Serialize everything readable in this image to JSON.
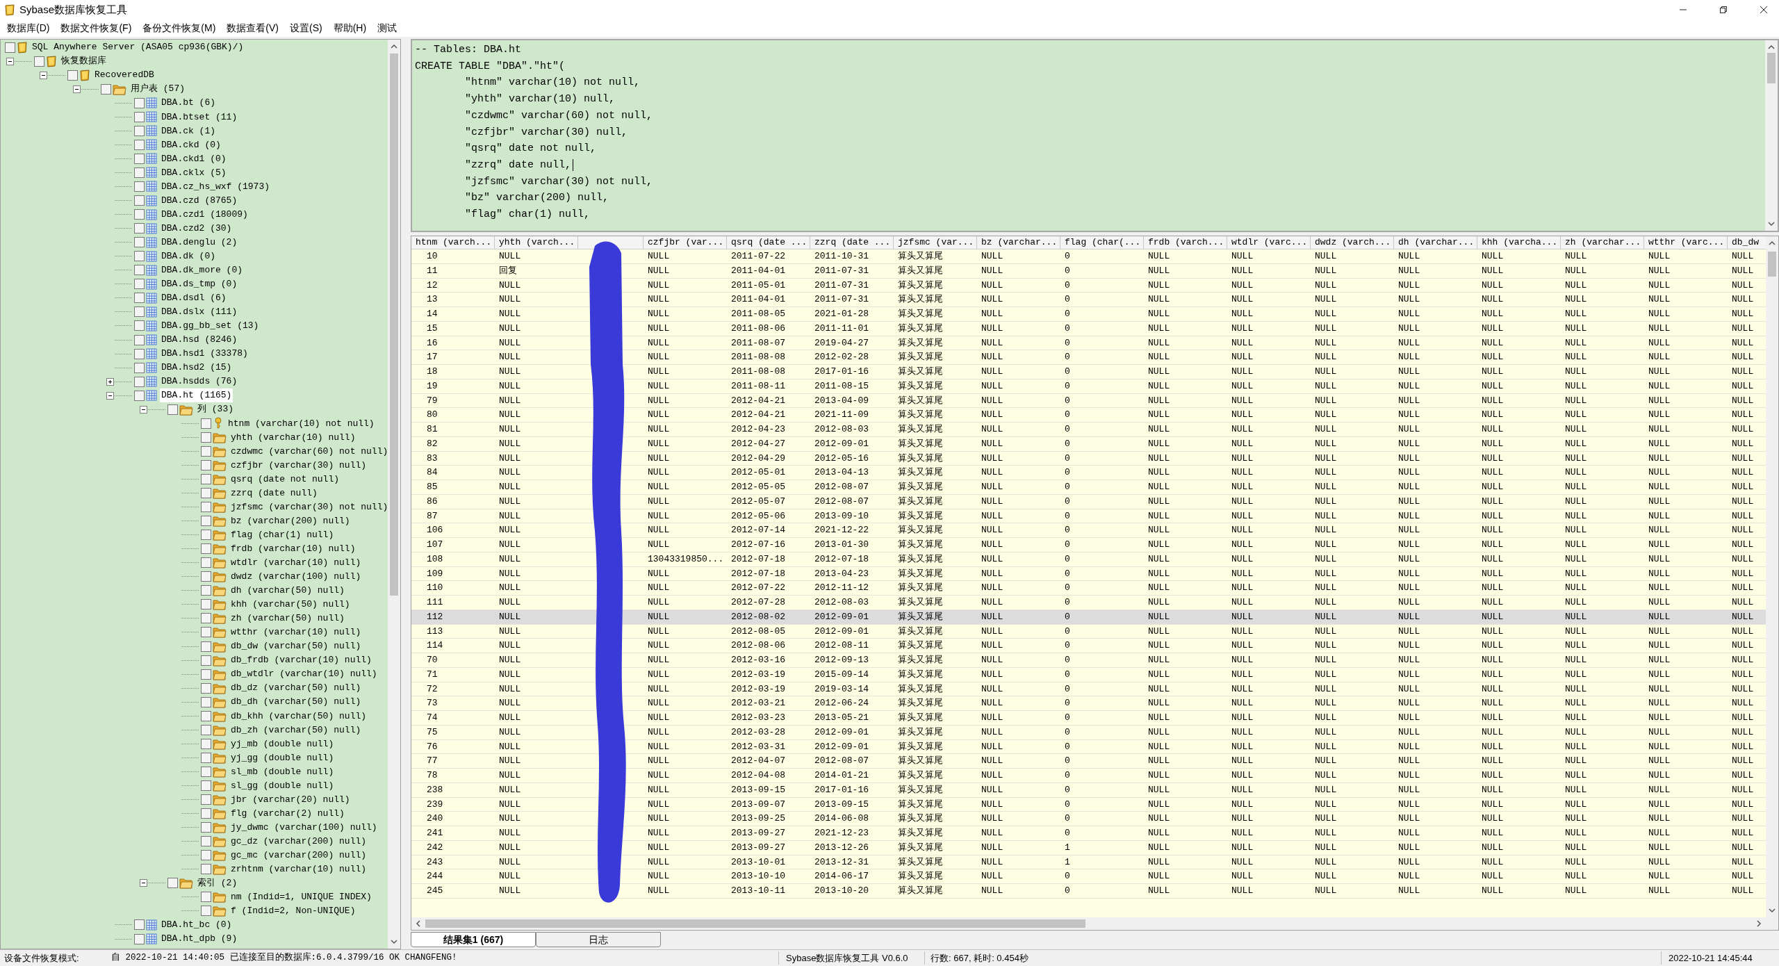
{
  "window": {
    "title": "Sybase数据库恢复工具"
  },
  "menu": [
    "数据库(D)",
    "数据文件恢复(F)",
    "备份文件恢复(M)",
    "数据查看(V)",
    "设置(S)",
    "帮助(H)",
    "测试"
  ],
  "tree": [
    {
      "label": "SQL Anywhere Server (ASA05 cp936(GBK)/)",
      "kind": "database",
      "checked": false,
      "selected": false,
      "children": [
        {
          "label": "恢复数据库",
          "kind": "database",
          "checked": false,
          "selected": false,
          "expanded": true,
          "children": [
            {
              "label": "RecoveredDB",
              "kind": "database",
              "checked": false,
              "selected": false,
              "expanded": true,
              "children": [
                {
                  "label": "用户表 (57)",
                  "kind": "folder",
                  "checked": false,
                  "selected": false,
                  "expanded": true,
                  "children": [
                    {
                      "label": "DBA.bt (6)",
                      "kind": "table",
                      "checked": false,
                      "selected": false
                    },
                    {
                      "label": "DBA.btset (11)",
                      "kind": "table",
                      "checked": false,
                      "selected": false
                    },
                    {
                      "label": "DBA.ck (1)",
                      "kind": "table",
                      "checked": false,
                      "selected": false
                    },
                    {
                      "label": "DBA.ckd (0)",
                      "kind": "table",
                      "checked": false,
                      "selected": false
                    },
                    {
                      "label": "DBA.ckd1 (0)",
                      "kind": "table",
                      "checked": false,
                      "selected": false
                    },
                    {
                      "label": "DBA.cklx (5)",
                      "kind": "table",
                      "checked": false,
                      "selected": false
                    },
                    {
                      "label": "DBA.cz_hs_wxf (1973)",
                      "kind": "table",
                      "checked": false,
                      "selected": false
                    },
                    {
                      "label": "DBA.czd (8765)",
                      "kind": "table",
                      "checked": false,
                      "selected": false
                    },
                    {
                      "label": "DBA.czd1 (18009)",
                      "kind": "table",
                      "checked": false,
                      "selected": false
                    },
                    {
                      "label": "DBA.czd2 (30)",
                      "kind": "table",
                      "checked": false,
                      "selected": false
                    },
                    {
                      "label": "DBA.denglu (2)",
                      "kind": "table",
                      "checked": false,
                      "selected": false
                    },
                    {
                      "label": "DBA.dk (0)",
                      "kind": "table",
                      "checked": false,
                      "selected": false
                    },
                    {
                      "label": "DBA.dk_more (0)",
                      "kind": "table",
                      "checked": false,
                      "selected": false
                    },
                    {
                      "label": "DBA.ds_tmp (0)",
                      "kind": "table",
                      "checked": false,
                      "selected": false
                    },
                    {
                      "label": "DBA.dsdl (6)",
                      "kind": "table",
                      "checked": false,
                      "selected": false
                    },
                    {
                      "label": "DBA.dslx (111)",
                      "kind": "table",
                      "checked": false,
                      "selected": false
                    },
                    {
                      "label": "DBA.gg_bb_set (13)",
                      "kind": "table",
                      "checked": false,
                      "selected": false
                    },
                    {
                      "label": "DBA.hsd (8246)",
                      "kind": "table",
                      "checked": false,
                      "selected": false
                    },
                    {
                      "label": "DBA.hsd1 (33378)",
                      "kind": "table",
                      "checked": false,
                      "selected": false
                    },
                    {
                      "label": "DBA.hsd2 (15)",
                      "kind": "table",
                      "checked": false,
                      "selected": false
                    },
                    {
                      "label": "DBA.hsdds (76)",
                      "kind": "table",
                      "checked": false,
                      "selected": false,
                      "expanded": false
                    },
                    {
                      "label": "DBA.ht (1165)",
                      "kind": "table",
                      "checked": false,
                      "selected": true,
                      "expanded": true,
                      "children": [
                        {
                          "label": "列 (33)",
                          "kind": "folder",
                          "checked": false,
                          "selected": false,
                          "expanded": true,
                          "children": [
                            {
                              "label": "htnm (varchar(10) not null)",
                              "kind": "key",
                              "checked": false,
                              "selected": false
                            },
                            {
                              "label": "yhth (varchar(10) null)",
                              "kind": "folder",
                              "checked": false,
                              "selected": false
                            },
                            {
                              "label": "czdwmc (varchar(60) not null)",
                              "kind": "folder",
                              "checked": false,
                              "selected": false
                            },
                            {
                              "label": "czfjbr (varchar(30) null)",
                              "kind": "folder",
                              "checked": false,
                              "selected": false
                            },
                            {
                              "label": "qsrq (date not null)",
                              "kind": "folder",
                              "checked": false,
                              "selected": false
                            },
                            {
                              "label": "zzrq (date null)",
                              "kind": "folder",
                              "checked": false,
                              "selected": false
                            },
                            {
                              "label": "jzfsmc (varchar(30) not null)",
                              "kind": "folder",
                              "checked": false,
                              "selected": false
                            },
                            {
                              "label": "bz (varchar(200) null)",
                              "kind": "folder",
                              "checked": false,
                              "selected": false
                            },
                            {
                              "label": "flag (char(1) null)",
                              "kind": "folder",
                              "checked": false,
                              "selected": false
                            },
                            {
                              "label": "frdb (varchar(10) null)",
                              "kind": "folder",
                              "checked": false,
                              "selected": false
                            },
                            {
                              "label": "wtdlr (varchar(10) null)",
                              "kind": "folder",
                              "checked": false,
                              "selected": false
                            },
                            {
                              "label": "dwdz (varchar(100) null)",
                              "kind": "folder",
                              "checked": false,
                              "selected": false
                            },
                            {
                              "label": "dh (varchar(50) null)",
                              "kind": "folder",
                              "checked": false,
                              "selected": false
                            },
                            {
                              "label": "khh (varchar(50) null)",
                              "kind": "folder",
                              "checked": false,
                              "selected": false
                            },
                            {
                              "label": "zh (varchar(50) null)",
                              "kind": "folder",
                              "checked": false,
                              "selected": false
                            },
                            {
                              "label": "wtthr (varchar(10) null)",
                              "kind": "folder",
                              "checked": false,
                              "selected": false
                            },
                            {
                              "label": "db_dw (varchar(50) null)",
                              "kind": "folder",
                              "checked": false,
                              "selected": false
                            },
                            {
                              "label": "db_frdb (varchar(10) null)",
                              "kind": "folder",
                              "checked": false,
                              "selected": false
                            },
                            {
                              "label": "db_wtdlr (varchar(10) null)",
                              "kind": "folder",
                              "checked": false,
                              "selected": false
                            },
                            {
                              "label": "db_dz (varchar(50) null)",
                              "kind": "folder",
                              "checked": false,
                              "selected": false
                            },
                            {
                              "label": "db_dh (varchar(50) null)",
                              "kind": "folder",
                              "checked": false,
                              "selected": false
                            },
                            {
                              "label": "db_khh (varchar(50) null)",
                              "kind": "folder",
                              "checked": false,
                              "selected": false
                            },
                            {
                              "label": "db_zh (varchar(50) null)",
                              "kind": "folder",
                              "checked": false,
                              "selected": false
                            },
                            {
                              "label": "yj_mb (double null)",
                              "kind": "folder",
                              "checked": false,
                              "selected": false
                            },
                            {
                              "label": "yj_gg (double null)",
                              "kind": "folder",
                              "checked": false,
                              "selected": false
                            },
                            {
                              "label": "sl_mb (double null)",
                              "kind": "folder",
                              "checked": false,
                              "selected": false
                            },
                            {
                              "label": "sl_gg (double null)",
                              "kind": "folder",
                              "checked": false,
                              "selected": false
                            },
                            {
                              "label": "jbr (varchar(20) null)",
                              "kind": "folder",
                              "checked": false,
                              "selected": false
                            },
                            {
                              "label": "flg (varchar(2) null)",
                              "kind": "folder",
                              "checked": false,
                              "selected": false
                            },
                            {
                              "label": "jy_dwmc (varchar(100) null)",
                              "kind": "folder",
                              "checked": false,
                              "selected": false
                            },
                            {
                              "label": "gc_dz (varchar(200) null)",
                              "kind": "folder",
                              "checked": false,
                              "selected": false
                            },
                            {
                              "label": "gc_mc (varchar(200) null)",
                              "kind": "folder",
                              "checked": false,
                              "selected": false
                            },
                            {
                              "label": "zrhtnm (varchar(10) null)",
                              "kind": "folder",
                              "checked": false,
                              "selected": false
                            }
                          ]
                        },
                        {
                          "label": "索引 (2)",
                          "kind": "folder",
                          "checked": false,
                          "selected": false,
                          "expanded": true,
                          "children": [
                            {
                              "label": "nm (Indid=1, UNIQUE INDEX)",
                              "kind": "folder",
                              "checked": false,
                              "selected": false
                            },
                            {
                              "label": "f (Indid=2, Non-UNIQUE)",
                              "kind": "folder",
                              "checked": false,
                              "selected": false
                            }
                          ]
                        }
                      ]
                    },
                    {
                      "label": "DBA.ht_bc (0)",
                      "kind": "table",
                      "checked": false,
                      "selected": false
                    },
                    {
                      "label": "DBA.ht_dpb (9)",
                      "kind": "table",
                      "checked": false,
                      "selected": false
                    }
                  ]
                }
              ]
            }
          ]
        }
      ]
    }
  ],
  "editor": {
    "lines": [
      {
        "text": "-- Tables: DBA.ht",
        "caret": false
      },
      {
        "text": "CREATE TABLE \"DBA\".\"ht\"(",
        "caret": false
      },
      {
        "text": "\t\"htnm\" varchar(10) not null,",
        "caret": false
      },
      {
        "text": "\t\"yhth\" varchar(10) null,",
        "caret": false
      },
      {
        "text": "\t\"czdwmc\" varchar(60) not null,",
        "caret": false
      },
      {
        "text": "\t\"czfjbr\" varchar(30) null,",
        "caret": false
      },
      {
        "text": "\t\"qsrq\" date not null,",
        "caret": false
      },
      {
        "text": "\t\"zzrq\" date null,",
        "caret": true
      },
      {
        "text": "\t\"jzfsmc\" varchar(30) not null,",
        "caret": false
      },
      {
        "text": "\t\"bz\" varchar(200) null,",
        "caret": false
      },
      {
        "text": "\t\"flag\" char(1) null,",
        "caret": false
      }
    ]
  },
  "table": {
    "columns": [
      {
        "label": "htnm (varch..."
      },
      {
        "label": "yhth (varch..."
      },
      {
        "redacted": true
      },
      {
        "label": "czfjbr (var..."
      },
      {
        "label": "qsrq (date ..."
      },
      {
        "label": "zzrq (date ..."
      },
      {
        "label": "jzfsmc (var..."
      },
      {
        "label": "bz (varchar..."
      },
      {
        "label": "flag (char(..."
      },
      {
        "label": "frdb (varch..."
      },
      {
        "label": "wtdlr (varc..."
      },
      {
        "label": "dwdz (varch..."
      },
      {
        "label": "dh (varchar..."
      },
      {
        "label": "khh (varcha..."
      },
      {
        "label": "zh (varchar..."
      },
      {
        "label": "wtthr (varc..."
      },
      {
        "label": "db_dw"
      }
    ],
    "rows": [
      {
        "selected": false,
        "cells": [
          "10",
          "NULL",
          null,
          "NULL",
          "2011-07-22",
          "2011-10-31",
          "算头又算尾",
          "NULL",
          "0",
          "NULL",
          "NULL",
          "NULL",
          "NULL",
          "NULL",
          "NULL",
          "NULL",
          "NULL"
        ]
      },
      {
        "selected": false,
        "cells": [
          "11",
          "回复",
          null,
          "NULL",
          "2011-04-01",
          "2011-07-31",
          "算头又算尾",
          "NULL",
          "0",
          "NULL",
          "NULL",
          "NULL",
          "NULL",
          "NULL",
          "NULL",
          "NULL",
          "NULL"
        ]
      },
      {
        "selected": false,
        "cells": [
          "12",
          "NULL",
          null,
          "NULL",
          "2011-05-01",
          "2011-07-31",
          "算头又算尾",
          "NULL",
          "0",
          "NULL",
          "NULL",
          "NULL",
          "NULL",
          "NULL",
          "NULL",
          "NULL",
          "NULL"
        ]
      },
      {
        "selected": false,
        "cells": [
          "13",
          "NULL",
          null,
          "NULL",
          "2011-04-01",
          "2011-07-31",
          "算头又算尾",
          "NULL",
          "0",
          "NULL",
          "NULL",
          "NULL",
          "NULL",
          "NULL",
          "NULL",
          "NULL",
          "NULL"
        ]
      },
      {
        "selected": false,
        "cells": [
          "14",
          "NULL",
          null,
          "NULL",
          "2011-08-05",
          "2021-01-28",
          "算头又算尾",
          "NULL",
          "0",
          "NULL",
          "NULL",
          "NULL",
          "NULL",
          "NULL",
          "NULL",
          "NULL",
          "NULL"
        ]
      },
      {
        "selected": false,
        "cells": [
          "15",
          "NULL",
          null,
          "NULL",
          "2011-08-06",
          "2011-11-01",
          "算头又算尾",
          "NULL",
          "0",
          "NULL",
          "NULL",
          "NULL",
          "NULL",
          "NULL",
          "NULL",
          "NULL",
          "NULL"
        ]
      },
      {
        "selected": false,
        "cells": [
          "16",
          "NULL",
          null,
          "NULL",
          "2011-08-07",
          "2019-04-27",
          "算头又算尾",
          "NULL",
          "0",
          "NULL",
          "NULL",
          "NULL",
          "NULL",
          "NULL",
          "NULL",
          "NULL",
          "NULL"
        ]
      },
      {
        "selected": false,
        "cells": [
          "17",
          "NULL",
          null,
          "NULL",
          "2011-08-08",
          "2012-02-28",
          "算头又算尾",
          "NULL",
          "0",
          "NULL",
          "NULL",
          "NULL",
          "NULL",
          "NULL",
          "NULL",
          "NULL",
          "NULL"
        ]
      },
      {
        "selected": false,
        "cells": [
          "18",
          "NULL",
          null,
          "NULL",
          "2011-08-08",
          "2017-01-16",
          "算头又算尾",
          "NULL",
          "0",
          "NULL",
          "NULL",
          "NULL",
          "NULL",
          "NULL",
          "NULL",
          "NULL",
          "NULL"
        ]
      },
      {
        "selected": false,
        "cells": [
          "19",
          "NULL",
          null,
          "NULL",
          "2011-08-11",
          "2011-08-15",
          "算头又算尾",
          "NULL",
          "0",
          "NULL",
          "NULL",
          "NULL",
          "NULL",
          "NULL",
          "NULL",
          "NULL",
          "NULL"
        ]
      },
      {
        "selected": false,
        "cells": [
          "79",
          "NULL",
          null,
          "NULL",
          "2012-04-21",
          "2013-04-09",
          "算头又算尾",
          "NULL",
          "0",
          "NULL",
          "NULL",
          "NULL",
          "NULL",
          "NULL",
          "NULL",
          "NULL",
          "NULL"
        ]
      },
      {
        "selected": false,
        "cells": [
          "80",
          "NULL",
          null,
          "NULL",
          "2012-04-21",
          "2021-11-09",
          "算头又算尾",
          "NULL",
          "0",
          "NULL",
          "NULL",
          "NULL",
          "NULL",
          "NULL",
          "NULL",
          "NULL",
          "NULL"
        ]
      },
      {
        "selected": false,
        "cells": [
          "81",
          "NULL",
          null,
          "NULL",
          "2012-04-23",
          "2012-08-03",
          "算头又算尾",
          "NULL",
          "0",
          "NULL",
          "NULL",
          "NULL",
          "NULL",
          "NULL",
          "NULL",
          "NULL",
          "NULL"
        ]
      },
      {
        "selected": false,
        "cells": [
          "82",
          "NULL",
          null,
          "NULL",
          "2012-04-27",
          "2012-09-01",
          "算头又算尾",
          "NULL",
          "0",
          "NULL",
          "NULL",
          "NULL",
          "NULL",
          "NULL",
          "NULL",
          "NULL",
          "NULL"
        ]
      },
      {
        "selected": false,
        "cells": [
          "83",
          "NULL",
          null,
          "NULL",
          "2012-04-29",
          "2012-05-16",
          "算头又算尾",
          "NULL",
          "0",
          "NULL",
          "NULL",
          "NULL",
          "NULL",
          "NULL",
          "NULL",
          "NULL",
          "NULL"
        ]
      },
      {
        "selected": false,
        "cells": [
          "84",
          "NULL",
          null,
          "NULL",
          "2012-05-01",
          "2013-04-13",
          "算头又算尾",
          "NULL",
          "0",
          "NULL",
          "NULL",
          "NULL",
          "NULL",
          "NULL",
          "NULL",
          "NULL",
          "NULL"
        ]
      },
      {
        "selected": false,
        "cells": [
          "85",
          "NULL",
          null,
          "NULL",
          "2012-05-05",
          "2012-08-07",
          "算头又算尾",
          "NULL",
          "0",
          "NULL",
          "NULL",
          "NULL",
          "NULL",
          "NULL",
          "NULL",
          "NULL",
          "NULL"
        ]
      },
      {
        "selected": false,
        "cells": [
          "86",
          "NULL",
          null,
          "NULL",
          "2012-05-07",
          "2012-08-07",
          "算头又算尾",
          "NULL",
          "0",
          "NULL",
          "NULL",
          "NULL",
          "NULL",
          "NULL",
          "NULL",
          "NULL",
          "NULL"
        ]
      },
      {
        "selected": false,
        "cells": [
          "87",
          "NULL",
          null,
          "NULL",
          "2012-05-06",
          "2013-09-10",
          "算头又算尾",
          "NULL",
          "0",
          "NULL",
          "NULL",
          "NULL",
          "NULL",
          "NULL",
          "NULL",
          "NULL",
          "NULL"
        ]
      },
      {
        "selected": false,
        "cells": [
          "106",
          "NULL",
          null,
          "NULL",
          "2012-07-14",
          "2021-12-22",
          "算头又算尾",
          "NULL",
          "0",
          "NULL",
          "NULL",
          "NULL",
          "NULL",
          "NULL",
          "NULL",
          "NULL",
          "NULL"
        ]
      },
      {
        "selected": false,
        "cells": [
          "107",
          "NULL",
          null,
          "NULL",
          "2012-07-16",
          "2013-01-30",
          "算头又算尾",
          "NULL",
          "0",
          "NULL",
          "NULL",
          "NULL",
          "NULL",
          "NULL",
          "NULL",
          "NULL",
          "NULL"
        ]
      },
      {
        "selected": false,
        "cells": [
          "108",
          "NULL",
          null,
          "13043319850...",
          "2012-07-18",
          "2012-07-18",
          "算头又算尾",
          "NULL",
          "0",
          "NULL",
          "NULL",
          "NULL",
          "NULL",
          "NULL",
          "NULL",
          "NULL",
          "NULL"
        ]
      },
      {
        "selected": false,
        "cells": [
          "109",
          "NULL",
          null,
          "NULL",
          "2012-07-18",
          "2013-04-23",
          "算头又算尾",
          "NULL",
          "0",
          "NULL",
          "NULL",
          "NULL",
          "NULL",
          "NULL",
          "NULL",
          "NULL",
          "NULL"
        ]
      },
      {
        "selected": false,
        "cells": [
          "110",
          "NULL",
          null,
          "NULL",
          "2012-07-22",
          "2012-11-12",
          "算头又算尾",
          "NULL",
          "0",
          "NULL",
          "NULL",
          "NULL",
          "NULL",
          "NULL",
          "NULL",
          "NULL",
          "NULL"
        ]
      },
      {
        "selected": false,
        "cells": [
          "111",
          "NULL",
          null,
          "NULL",
          "2012-07-28",
          "2012-08-03",
          "算头又算尾",
          "NULL",
          "0",
          "NULL",
          "NULL",
          "NULL",
          "NULL",
          "NULL",
          "NULL",
          "NULL",
          "NULL"
        ]
      },
      {
        "selected": true,
        "cells": [
          "112",
          "NULL",
          null,
          "NULL",
          "2012-08-02",
          "2012-09-01",
          "算头又算尾",
          "NULL",
          "0",
          "NULL",
          "NULL",
          "NULL",
          "NULL",
          "NULL",
          "NULL",
          "NULL",
          "NULL"
        ]
      },
      {
        "selected": false,
        "cells": [
          "113",
          "NULL",
          null,
          "NULL",
          "2012-08-05",
          "2012-09-01",
          "算头又算尾",
          "NULL",
          "0",
          "NULL",
          "NULL",
          "NULL",
          "NULL",
          "NULL",
          "NULL",
          "NULL",
          "NULL"
        ]
      },
      {
        "selected": false,
        "cells": [
          "114",
          "NULL",
          null,
          "NULL",
          "2012-08-06",
          "2012-08-11",
          "算头又算尾",
          "NULL",
          "0",
          "NULL",
          "NULL",
          "NULL",
          "NULL",
          "NULL",
          "NULL",
          "NULL",
          "NULL"
        ]
      },
      {
        "selected": false,
        "cells": [
          "70",
          "NULL",
          null,
          "NULL",
          "2012-03-16",
          "2012-09-13",
          "算头又算尾",
          "NULL",
          "0",
          "NULL",
          "NULL",
          "NULL",
          "NULL",
          "NULL",
          "NULL",
          "NULL",
          "NULL"
        ]
      },
      {
        "selected": false,
        "cells": [
          "71",
          "NULL",
          null,
          "NULL",
          "2012-03-19",
          "2015-09-14",
          "算头又算尾",
          "NULL",
          "0",
          "NULL",
          "NULL",
          "NULL",
          "NULL",
          "NULL",
          "NULL",
          "NULL",
          "NULL"
        ]
      },
      {
        "selected": false,
        "cells": [
          "72",
          "NULL",
          null,
          "NULL",
          "2012-03-19",
          "2019-03-14",
          "算头又算尾",
          "NULL",
          "0",
          "NULL",
          "NULL",
          "NULL",
          "NULL",
          "NULL",
          "NULL",
          "NULL",
          "NULL"
        ]
      },
      {
        "selected": false,
        "cells": [
          "73",
          "NULL",
          null,
          "NULL",
          "2012-03-21",
          "2012-06-24",
          "算头又算尾",
          "NULL",
          "0",
          "NULL",
          "NULL",
          "NULL",
          "NULL",
          "NULL",
          "NULL",
          "NULL",
          "NULL"
        ]
      },
      {
        "selected": false,
        "cells": [
          "74",
          "NULL",
          null,
          "NULL",
          "2012-03-23",
          "2013-05-21",
          "算头又算尾",
          "NULL",
          "0",
          "NULL",
          "NULL",
          "NULL",
          "NULL",
          "NULL",
          "NULL",
          "NULL",
          "NULL"
        ]
      },
      {
        "selected": false,
        "cells": [
          "75",
          "NULL",
          null,
          "NULL",
          "2012-03-28",
          "2012-09-01",
          "算头又算尾",
          "NULL",
          "0",
          "NULL",
          "NULL",
          "NULL",
          "NULL",
          "NULL",
          "NULL",
          "NULL",
          "NULL"
        ]
      },
      {
        "selected": false,
        "cells": [
          "76",
          "NULL",
          null,
          "NULL",
          "2012-03-31",
          "2012-09-01",
          "算头又算尾",
          "NULL",
          "0",
          "NULL",
          "NULL",
          "NULL",
          "NULL",
          "NULL",
          "NULL",
          "NULL",
          "NULL"
        ]
      },
      {
        "selected": false,
        "cells": [
          "77",
          "NULL",
          null,
          "NULL",
          "2012-04-07",
          "2012-08-07",
          "算头又算尾",
          "NULL",
          "0",
          "NULL",
          "NULL",
          "NULL",
          "NULL",
          "NULL",
          "NULL",
          "NULL",
          "NULL"
        ]
      },
      {
        "selected": false,
        "cells": [
          "78",
          "NULL",
          null,
          "NULL",
          "2012-04-08",
          "2014-01-21",
          "算头又算尾",
          "NULL",
          "0",
          "NULL",
          "NULL",
          "NULL",
          "NULL",
          "NULL",
          "NULL",
          "NULL",
          "NULL"
        ]
      },
      {
        "selected": false,
        "cells": [
          "238",
          "NULL",
          null,
          "NULL",
          "2013-09-15",
          "2017-01-16",
          "算头又算尾",
          "NULL",
          "0",
          "NULL",
          "NULL",
          "NULL",
          "NULL",
          "NULL",
          "NULL",
          "NULL",
          "NULL"
        ]
      },
      {
        "selected": false,
        "cells": [
          "239",
          "NULL",
          null,
          "NULL",
          "2013-09-07",
          "2013-09-15",
          "算头又算尾",
          "NULL",
          "0",
          "NULL",
          "NULL",
          "NULL",
          "NULL",
          "NULL",
          "NULL",
          "NULL",
          "NULL"
        ]
      },
      {
        "selected": false,
        "cells": [
          "240",
          "NULL",
          null,
          "NULL",
          "2013-09-25",
          "2014-06-08",
          "算头又算尾",
          "NULL",
          "0",
          "NULL",
          "NULL",
          "NULL",
          "NULL",
          "NULL",
          "NULL",
          "NULL",
          "NULL"
        ]
      },
      {
        "selected": false,
        "cells": [
          "241",
          "NULL",
          null,
          "NULL",
          "2013-09-27",
          "2021-12-23",
          "算头又算尾",
          "NULL",
          "0",
          "NULL",
          "NULL",
          "NULL",
          "NULL",
          "NULL",
          "NULL",
          "NULL",
          "NULL"
        ]
      },
      {
        "selected": false,
        "cells": [
          "242",
          "NULL",
          null,
          "NULL",
          "2013-09-27",
          "2013-12-26",
          "算头又算尾",
          "NULL",
          "1",
          "NULL",
          "NULL",
          "NULL",
          "NULL",
          "NULL",
          "NULL",
          "NULL",
          "NULL"
        ]
      },
      {
        "selected": false,
        "cells": [
          "243",
          "NULL",
          null,
          "NULL",
          "2013-10-01",
          "2013-12-31",
          "算头又算尾",
          "NULL",
          "1",
          "NULL",
          "NULL",
          "NULL",
          "NULL",
          "NULL",
          "NULL",
          "NULL",
          "NULL"
        ]
      },
      {
        "selected": false,
        "cells": [
          "244",
          "NULL",
          null,
          "NULL",
          "2013-10-10",
          "2014-06-17",
          "算头又算尾",
          "NULL",
          "0",
          "NULL",
          "NULL",
          "NULL",
          "NULL",
          "NULL",
          "NULL",
          "NULL",
          "NULL"
        ]
      },
      {
        "selected": false,
        "cells": [
          "245",
          "NULL",
          null,
          "NULL",
          "2013-10-11",
          "2013-10-20",
          "算头又算尾",
          "NULL",
          "0",
          "NULL",
          "NULL",
          "NULL",
          "NULL",
          "NULL",
          "NULL",
          "NULL",
          "NULL"
        ]
      }
    ]
  },
  "result_tabs": [
    {
      "label": "结果集1 (667)",
      "selected": true
    },
    {
      "label": "日志",
      "selected": false
    }
  ],
  "status_bar": {
    "mode": "设备文件恢复模式:",
    "message": "自 2022-10-21 14:40:05 已连接至目的数据库:6.0.4.3799/16 OK  CHANGFENG!",
    "app": "Sybase数据库恢复工具 V0.6.0",
    "stats": "行数: 667, 耗时: 0.454秒",
    "time": "2022-10-21 14:45:44"
  }
}
